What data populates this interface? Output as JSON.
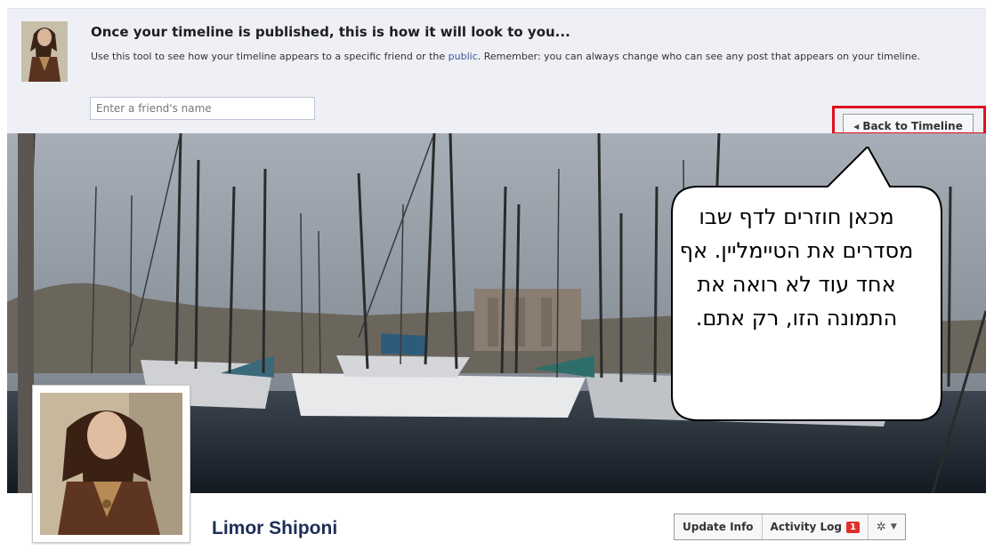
{
  "preview": {
    "title": "Once your timeline is published, this is how it will look to you...",
    "desc_before": "Use this tool to see how your timeline appears to a specific friend or the ",
    "desc_link": "public",
    "desc_after": ". Remember: you can always change who can see any post that appears on your timeline.",
    "friend_placeholder": "Enter a friend's name",
    "back_button": "Back to Timeline"
  },
  "callout": {
    "text": "מכאן חוזרים לדף שבו מסדרים את הטיימליין. אף אחד עוד לא רואה את התמונה הזו, רק אתם."
  },
  "profile": {
    "name": "Limor Shiponi",
    "update_info": "Update Info",
    "activity_log": "Activity Log",
    "activity_badge": "1"
  },
  "colors": {
    "accent": "#3b5998",
    "highlight": "#e01020",
    "badge": "#e0302a"
  },
  "icons": [
    "back-arrow-icon",
    "gear-icon",
    "chevron-down-icon"
  ]
}
